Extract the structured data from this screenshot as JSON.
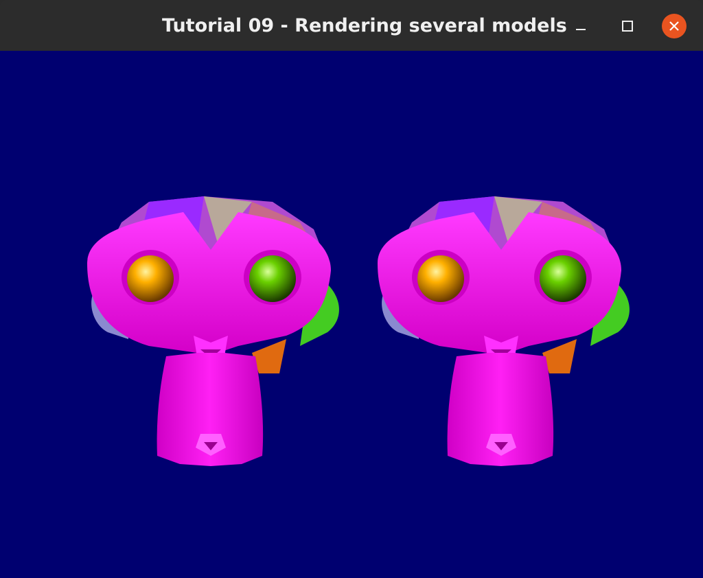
{
  "window": {
    "title": "Tutorial 09 - Rendering several models",
    "controls": [
      "minimize",
      "maximize",
      "close"
    ]
  },
  "scene": {
    "background_color": "#000070",
    "models": [
      {
        "name": "monkey-head-left",
        "color": "#ff00ff",
        "left_eye_color": "#ffa500",
        "right_eye_color": "#66dd00"
      },
      {
        "name": "monkey-head-right",
        "color": "#ff00ff",
        "left_eye_color": "#ffa500",
        "right_eye_color": "#66dd00"
      }
    ]
  },
  "colors": {
    "titlebar": "#2c2c2c",
    "close_button": "#e95420",
    "title_text": "#f0f0f0"
  }
}
